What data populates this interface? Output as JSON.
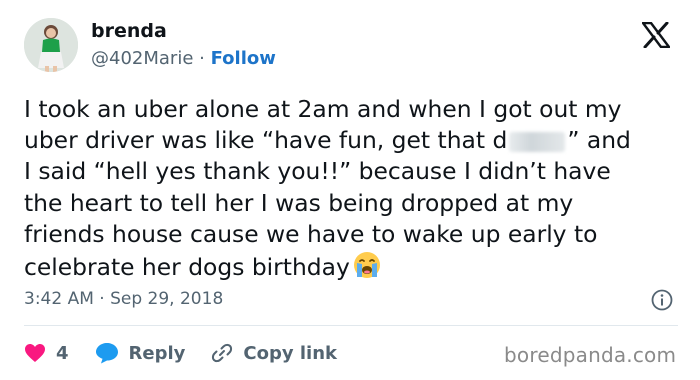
{
  "header": {
    "display_name": "brenda",
    "handle": "@402Marie",
    "separator": "·",
    "follow_label": "Follow"
  },
  "tweet": {
    "text_part1": "I took an uber alone at 2am and when I got out my\nuber driver was like “have fun, get that d",
    "redacted_word": "",
    "text_part2": "” and\nI said “hell yes thank you!!” because I didn’t have\nthe heart to tell her I was being dropped at my\nfriends house cause we have to wake up early to\ncelebrate her dogs birthday",
    "emoji_name": "loudly-crying-face"
  },
  "meta": {
    "time": "3:42 AM",
    "separator": "·",
    "date": "Sep 29, 2018"
  },
  "actions": {
    "like_count": "4",
    "reply_label": "Reply",
    "copy_link_label": "Copy link"
  },
  "watermark": "boredpanda.com",
  "colors": {
    "text": "#0f1419",
    "muted": "#536471",
    "link": "#1d74c9",
    "heart": "#f91880",
    "reply_bubble": "#1d9bf0",
    "divider": "#e1e8ed",
    "watermark": "#8a8a8a"
  },
  "icons": [
    "x-logo-icon",
    "info-icon",
    "heart-icon",
    "reply-bubble-icon",
    "link-icon"
  ]
}
